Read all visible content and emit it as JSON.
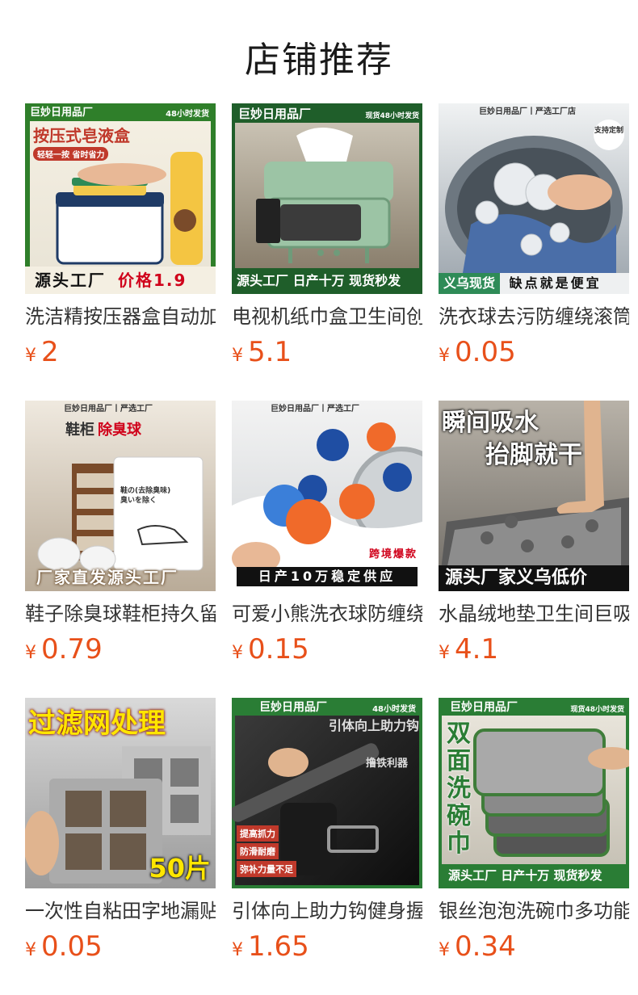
{
  "shop": {
    "title": "店铺推荐"
  },
  "products": [
    {
      "name": "洗洁精按压器盒自动加液",
      "price": "2",
      "currency": "¥",
      "banner_top": "巨妙日用品厂",
      "banner_top_right": "48小时发货",
      "headline": "按压式皂液盒",
      "subline": "轻轻一按 省时省力",
      "banner_bottom": "源头工厂",
      "banner_bottom_accent": "价格1.9"
    },
    {
      "name": "电视机纸巾盒卫生间创意",
      "price": "5.1",
      "currency": "¥",
      "banner_top": "巨妙日用品厂",
      "banner_top_right": "现货48小时发货",
      "banner_bottom": "源头工厂 日产十万 现货秒发"
    },
    {
      "name": "洗衣球去污防缠绕滚筒",
      "price": "0.05",
      "currency": "¥",
      "banner_top": "巨妙日用品厂丨严选工厂店",
      "badge": "支持定制",
      "banner_bottom_left": "义乌现货",
      "banner_bottom": "缺点就是便宜"
    },
    {
      "name": "鞋子除臭球鞋柜持久留香",
      "price": "0.79",
      "currency": "¥",
      "banner_top": "巨妙日用品厂丨严选工厂",
      "headline_left": "鞋柜",
      "headline_accent": "除臭球",
      "bag_text": "鞋の(去除臭味)臭いを除く",
      "banner_bottom": "厂家直发源头工厂"
    },
    {
      "name": "可爱小熊洗衣球防缠绕",
      "price": "0.15",
      "currency": "¥",
      "banner_top": "巨妙日用品厂丨严选工厂",
      "corner_tag": "跨境爆款",
      "banner_bottom": "日产10万稳定供应"
    },
    {
      "name": "水晶绒地垫卫生间巨吸水",
      "price": "4.1",
      "currency": "¥",
      "headline": "瞬间吸水",
      "subline": "抬脚就干",
      "banner_bottom": "源头厂家义乌低价"
    },
    {
      "name": "一次性自粘田字地漏贴",
      "price": "0.05",
      "currency": "¥",
      "headline": "过滤网处理",
      "corner_tag": "50片"
    },
    {
      "name": "引体向上助力钩健身握力",
      "price": "1.65",
      "currency": "¥",
      "banner_top": "巨妙日用品厂",
      "banner_top_right": "48小时发货",
      "headline": "引体向上助力钩",
      "subline": "撸铁利器",
      "features": [
        "提高抓力",
        "防滑耐磨",
        "弥补力量不足"
      ]
    },
    {
      "name": "银丝泡泡洗碗巾多功能",
      "price": "0.34",
      "currency": "¥",
      "banner_top": "巨妙日用品厂",
      "banner_top_right": "现货48小时发货",
      "headline": "双面洗碗巾",
      "banner_bottom": "源头工厂 日产十万 现货秒发"
    }
  ]
}
